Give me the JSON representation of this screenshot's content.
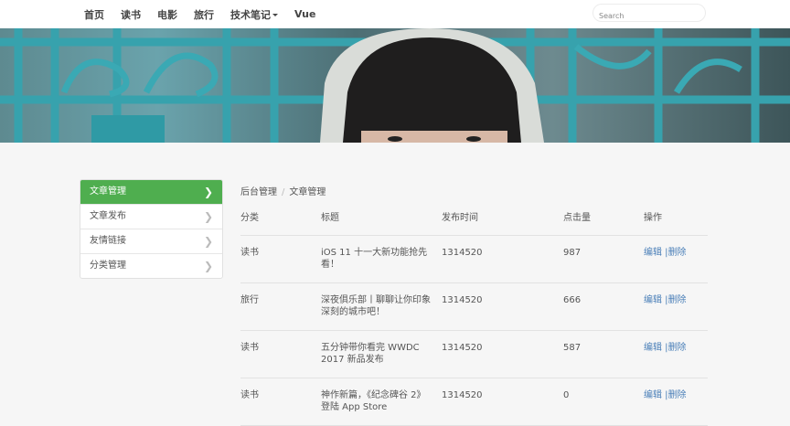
{
  "nav": {
    "items": [
      {
        "label": "首页"
      },
      {
        "label": "读书"
      },
      {
        "label": "电影"
      },
      {
        "label": "旅行"
      },
      {
        "label": "技术笔记"
      },
      {
        "label": "Vue"
      }
    ],
    "search_placeholder": "Search"
  },
  "sidebar": {
    "items": [
      {
        "label": "文章管理"
      },
      {
        "label": "文章发布"
      },
      {
        "label": "友情链接"
      },
      {
        "label": "分类管理"
      }
    ]
  },
  "breadcrumb": {
    "items": [
      "后台管理",
      "文章管理"
    ]
  },
  "table": {
    "headers": {
      "category": "分类",
      "title": "标题",
      "time": "发布时间",
      "clicks": "点击量",
      "ops": "操作"
    },
    "rows": [
      {
        "category": "读书",
        "title": "iOS 11 十一大新功能抢先看！",
        "time": "1314520",
        "clicks": "987",
        "edit": "编辑",
        "delete": "删除"
      },
      {
        "category": "旅行",
        "title": "深夜俱乐部丨聊聊让你印象深刻的城市吧！",
        "time": "1314520",
        "clicks": "666",
        "edit": "编辑",
        "delete": "删除"
      },
      {
        "category": "读书",
        "title": "五分钟带你看完 WWDC 2017 新品发布",
        "time": "1314520",
        "clicks": "587",
        "edit": "编辑",
        "delete": "删除"
      },
      {
        "category": "读书",
        "title": "神作新篇，《纪念碑谷 2》登陆 App Store",
        "time": "1314520",
        "clicks": "0",
        "edit": "编辑",
        "delete": "删除"
      }
    ]
  }
}
